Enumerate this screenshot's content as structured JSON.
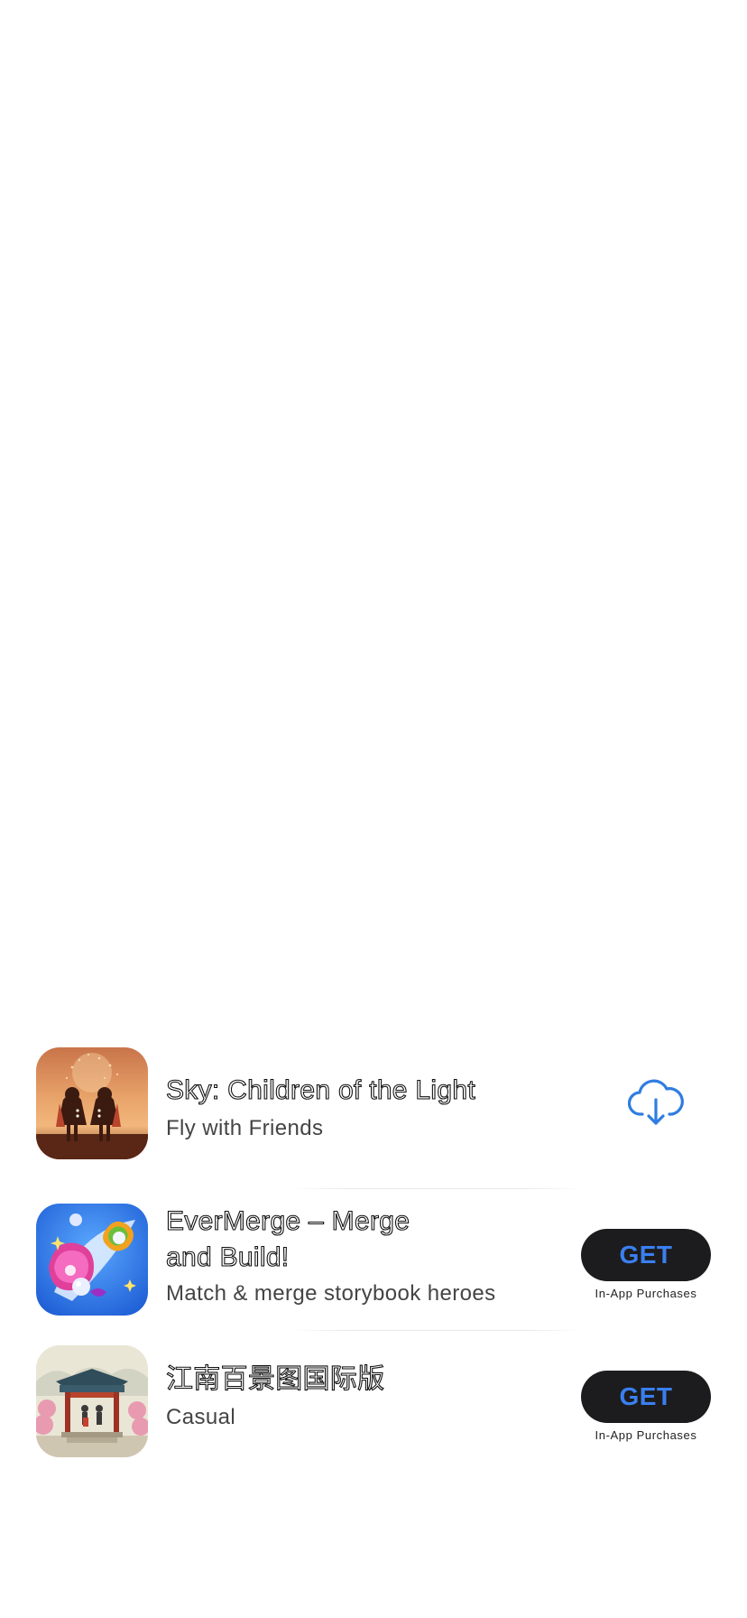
{
  "apps": [
    {
      "title": "Sky: Children of the Light",
      "subtitle": "Fly with Friends",
      "action": "download",
      "icon": "sky-children-of-light-icon",
      "download_icon": "cloud-download-icon"
    },
    {
      "title_line1": "EverMerge – Merge",
      "title_line2": "and Build!",
      "subtitle": "Match & merge storybook heroes",
      "action": "get",
      "button_label": "GET",
      "iap_label": "In-App Purchases",
      "icon": "evermerge-icon"
    },
    {
      "title": "江南百景图国际版",
      "subtitle": "Casual",
      "action": "get",
      "button_label": "GET",
      "iap_label": "In-App Purchases",
      "icon": "jiangnan-icon"
    }
  ],
  "colors": {
    "button_bg": "#1c1c1e",
    "button_text": "#3a7ff0",
    "download_icon": "#2f7de1"
  }
}
